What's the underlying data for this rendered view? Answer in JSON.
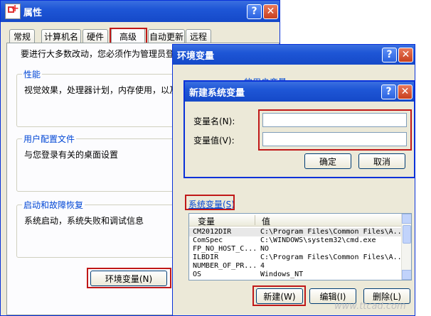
{
  "sys_props": {
    "title": "属性",
    "tabs": [
      "常规",
      "计算机名",
      "硬件",
      "高级",
      "自动更新",
      "远程"
    ],
    "admin_note": "要进行大多数改动，您必须作为管理员登录。",
    "perf_group": "性能",
    "perf_desc": "视觉效果，处理器计划，内存使用，以及虚",
    "profile_group": "用户配置文件",
    "profile_desc": "与您登录有关的桌面设置",
    "startup_group": "启动和故障恢复",
    "startup_desc": "系统启动，系统失败和调试信息",
    "env_button": "环境变量(N)",
    "help_glyph": "?",
    "close_glyph": "✕"
  },
  "env_dialog": {
    "title": "环境变量",
    "user_vars_label": "的用户变量",
    "sys_vars_label": "系统变量(S)",
    "columns": [
      "变量",
      "值"
    ],
    "rows": [
      {
        "name": "CM2012DIR",
        "value": "C:\\Program Files\\Common Files\\A..."
      },
      {
        "name": "ComSpec",
        "value": "C:\\WINDOWS\\system32\\cmd.exe"
      },
      {
        "name": "FP_NO_HOST_C...",
        "value": "NO"
      },
      {
        "name": "ILBDIR",
        "value": "C:\\Program Files\\Common Files\\A..."
      },
      {
        "name": "NUMBER_OF_PR...",
        "value": "4"
      },
      {
        "name": "OS",
        "value": "Windows_NT"
      }
    ],
    "new_button": "新建(W)",
    "edit_button": "编辑(I)",
    "delete_button": "删除(L)"
  },
  "new_var_dialog": {
    "title": "新建系统变量",
    "name_label": "变量名(N):",
    "value_label": "变量值(V):",
    "name_value": "",
    "value_value": "",
    "ok_button": "确定",
    "cancel_button": "取消"
  },
  "watermark": "www.ttcad.com"
}
